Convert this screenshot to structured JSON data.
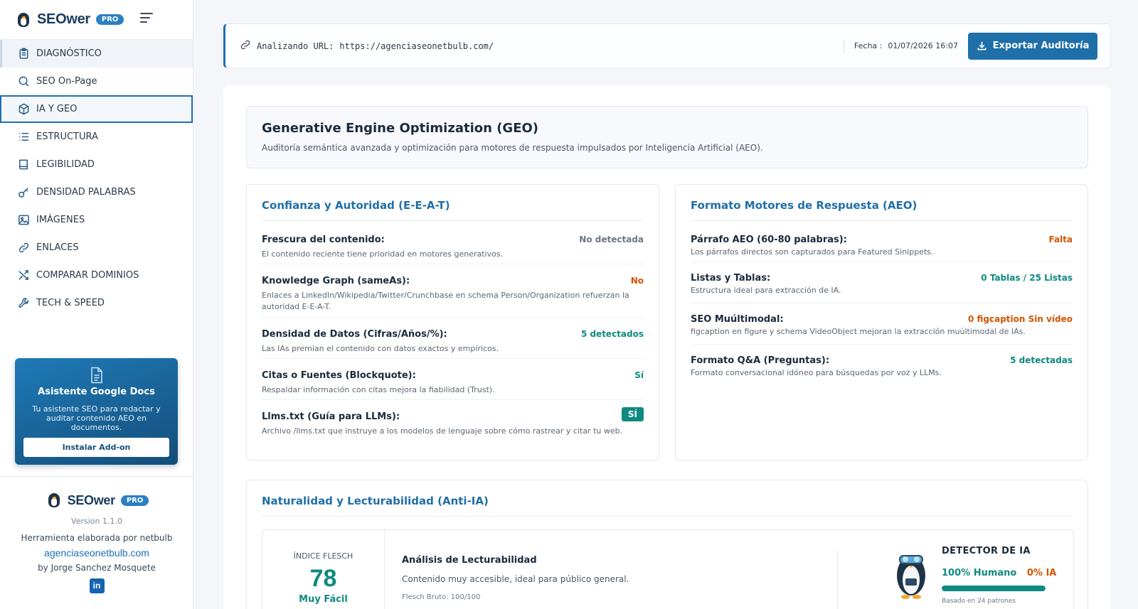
{
  "app": {
    "name": "SEOwer",
    "badge": "PRO"
  },
  "sidebar": {
    "items": [
      {
        "label": "DIAGNÓSTICO"
      },
      {
        "label": "SEO On-Page"
      },
      {
        "label": "IA Y GEO"
      },
      {
        "label": "ESTRUCTURA"
      },
      {
        "label": "LEGIBILIDAD"
      },
      {
        "label": "DENSIDAD PALABRAS"
      },
      {
        "label": "IMÁGENES"
      },
      {
        "label": "ENLACES"
      },
      {
        "label": "COMPARAR DOMINIOS"
      },
      {
        "label": "TECH & SPEED"
      }
    ],
    "addon": {
      "title": "Asistente Google Docs",
      "text": "Tu asistente SEO para redactar y auditar contenido AEO en documentos.",
      "button": "Instalar Add-on"
    },
    "footer": {
      "version": "Version 1.1.0",
      "made_by": "Herramienta elaborada por netbulb",
      "site": "agenciaseonetbulb.com",
      "author": "by Jorge Sanchez Mosquete",
      "social": "in"
    }
  },
  "header": {
    "url_label": "Analizando URL:",
    "url": "https://agenciaseonetbulb.com/",
    "date_label": "Fecha :",
    "date_value": "01/07/2026 16:07",
    "export_label": "Exportar Auditoría"
  },
  "geo": {
    "title": "Generative Engine Optimization (GEO)",
    "subtitle": "Auditoría semántica avanzada y optimización para motores de respuesta impulsados por Inteligencia Artificial (AEO)."
  },
  "eeat": {
    "title": "Confianza y Autoridad (E-E-A-T)",
    "rows": [
      {
        "label": "Frescura del contenido:",
        "desc": "El contenido reciente tiene prioridad en motores generativos.",
        "value": "No detectada",
        "tone": "gray"
      },
      {
        "label": "Knowledge Graph (sameAs):",
        "desc": "Enlaces a LinkedIn/Wikipedia/Twitter/Crunchbase en schema Person/Organization refuerzan la autoridad E-E-A-T.",
        "value": "No",
        "tone": "orange"
      },
      {
        "label": "Densidad de Datos (Cifras/Años/%):",
        "desc": "Las IAs premian el contenido con datos exactos y empíricos.",
        "value": "5 detectados",
        "tone": "teal"
      },
      {
        "label": "Citas o Fuentes (Blockquote):",
        "desc": "Respaldar información con citas mejora la fiabilidad (Trust).",
        "value": "Sí",
        "tone": "teal"
      },
      {
        "label": "Llms.txt (Guía para LLMs):",
        "desc": "Archivo /llms.txt que instruye a los modelos de lenguaje sobre cómo rastrear y citar tu web.",
        "value": "SÍ",
        "tone": "pill"
      }
    ]
  },
  "aeo": {
    "title": "Formato Motores de Respuesta (AEO)",
    "rows": [
      {
        "label": "Párrafo AEO (60-80 palabras):",
        "desc": "Los párrafos directos son capturados para Featured Sinippets.",
        "value": "Falta",
        "tone": "orange"
      },
      {
        "label": "Listas y Tablas:",
        "desc": "Estructura ideal para extracción de IA.",
        "value": "0 Tablas / 25 Listas",
        "tone": "teal"
      },
      {
        "label": "SEO Muúltimodal:",
        "desc": "figcaption en figure y schema VideoObject mejoran la extracción muúltimodal de IAs.",
        "value": "0 figcaption Sin vídeo",
        "tone": "orange"
      },
      {
        "label": "Formato Q&A (Preguntas):",
        "desc": "Formato conversacional idóneo para búsquedas por voz y LLMs.",
        "value": "5 detectadas",
        "tone": "teal"
      }
    ]
  },
  "naturalness": {
    "title": "Naturalidad y Lecturabilidad (Anti-IA)",
    "flesch_label": "ÍNDICE FLESCH",
    "flesch_score": "78",
    "flesch_level": "Muy Fácil",
    "analysis_title": "Análisis de Lecturabilidad",
    "analysis_desc": "Contenido muy accesible, ideal para público general.",
    "flesch_raw": "Flesch Bruto: 100/100",
    "detector_title": "DETECTOR DE IA",
    "human": "100% Humano",
    "ai": "0% IA",
    "human_fraction": 1.0,
    "note": "Basado en 24 patrones"
  },
  "colors": {
    "accent": "#1f6fa8",
    "teal": "#0e8a80",
    "orange": "#d35400"
  }
}
